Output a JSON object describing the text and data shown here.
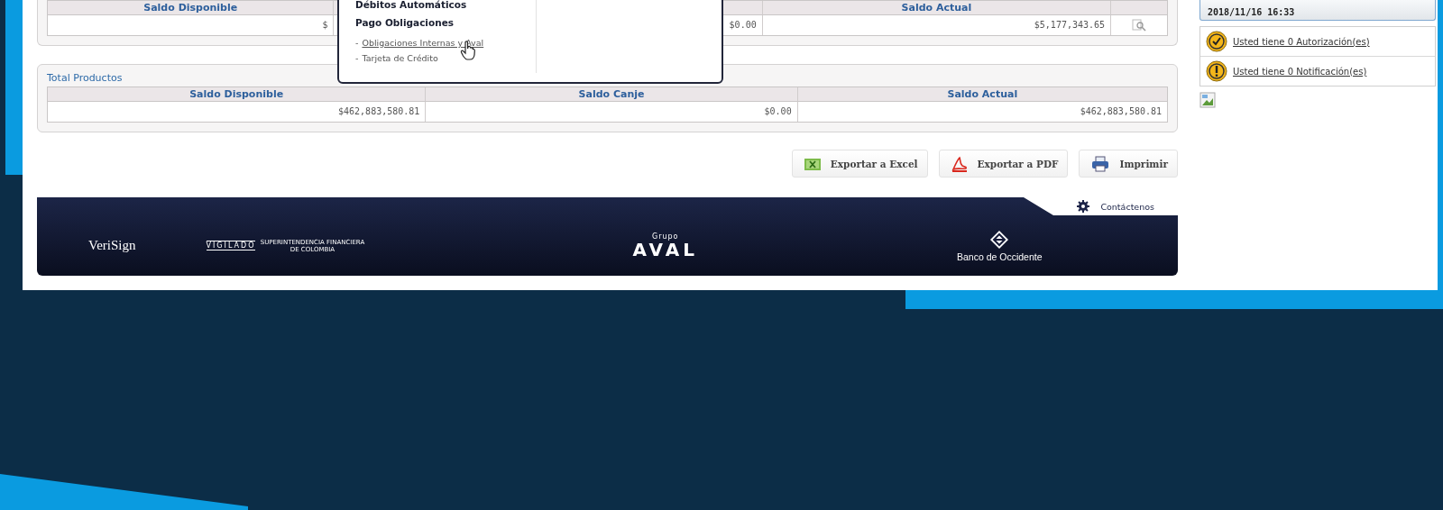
{
  "account_table": {
    "columns": [
      {
        "kind": "text",
        "label": "Saldo Disponible"
      },
      {
        "kind": "blank"
      },
      {
        "kind": "text",
        "label": "Saldo Actual"
      },
      {
        "kind": "blank"
      }
    ],
    "row": [
      {
        "kind": "text",
        "text": "$"
      },
      {
        "kind": "text",
        "text": "$0.00"
      },
      {
        "kind": "text",
        "text": "$5,177,343.65"
      },
      {
        "kind": "view_icon"
      }
    ]
  },
  "menu_popup": {
    "sections": [
      {
        "title": "Débitos Automáticos"
      },
      {
        "title": "Pago Obligaciones",
        "links": [
          {
            "marker": "-",
            "label": "Obligaciones Internas y Aval",
            "hovered": true
          },
          {
            "marker": "-",
            "label": "Tarjeta de Crédito",
            "hovered": false
          }
        ]
      }
    ]
  },
  "total_products": {
    "title": "Total Productos",
    "columns": [
      "Saldo Disponible",
      "Saldo Canje",
      "Saldo Actual"
    ],
    "row": [
      "$462,883,580.81",
      "$0.00",
      "$462,883,580.81"
    ]
  },
  "actions": [
    {
      "kind": "excel",
      "label": "Exportar a Excel"
    },
    {
      "kind": "pdf",
      "label": "Exportar a PDF"
    },
    {
      "kind": "print",
      "label": "Imprimir"
    }
  ],
  "footer": {
    "contact": "Contáctenos",
    "verisign": "VeriSign",
    "vigilado": "VIGILADO",
    "superintendencia": "SUPERINTENDENCIA FINANCIERA DE COLOMBIA",
    "grupo": "Grupo",
    "aval": "AVAL",
    "bank": "Banco de Occidente"
  },
  "sidebar": {
    "last_login": "2018/11/16 16:33",
    "alerts": [
      {
        "kind": "authorization",
        "text": "Usted tiene 0 Autorización(es)"
      },
      {
        "kind": "notification",
        "text": "Usted tiene 0 Notificación(es)"
      }
    ]
  }
}
